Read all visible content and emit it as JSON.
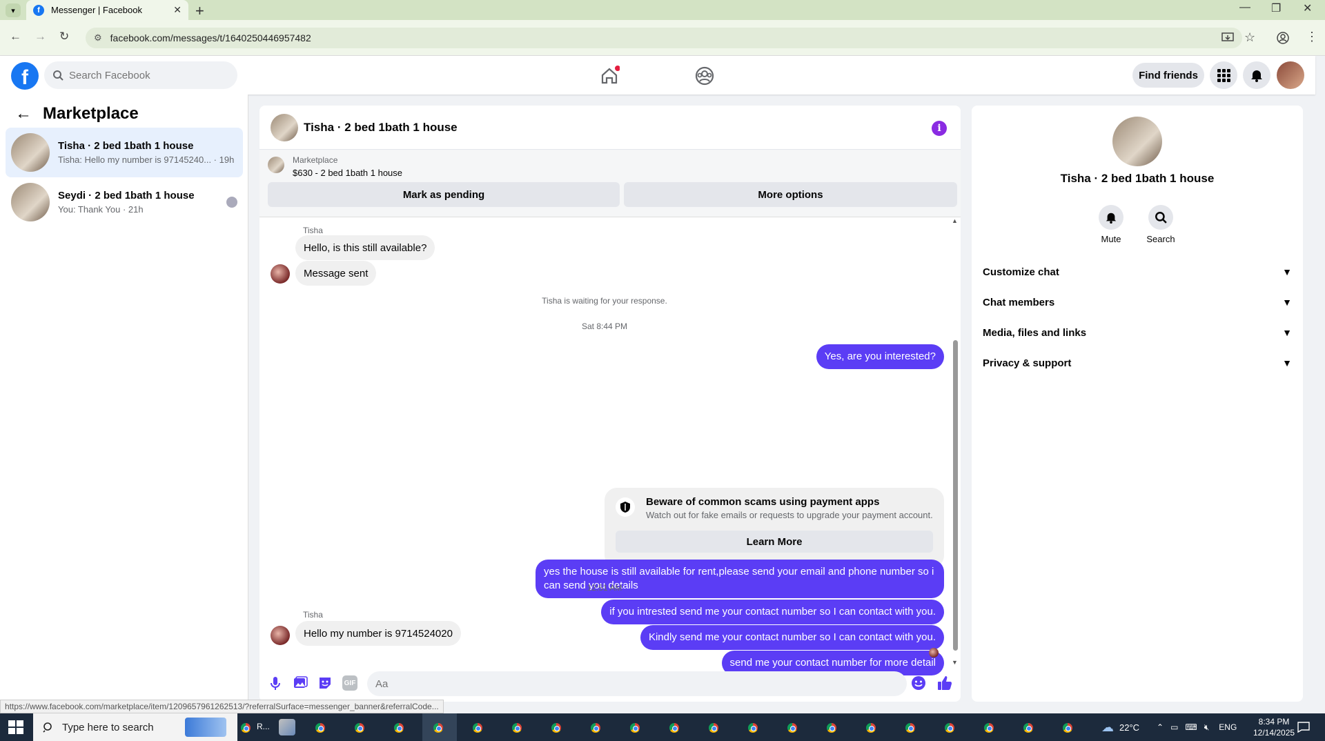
{
  "browser": {
    "tab_title": "Messenger | Facebook",
    "tab_close": "✕",
    "new_tab": "+",
    "url": "facebook.com/messages/t/1640250446957482",
    "status_url": "https://www.facebook.com/marketplace/item/1209657961262513/?referralSurface=messenger_banner&referralCode..."
  },
  "fb": {
    "search_placeholder": "Search Facebook",
    "find_friends": "Find friends",
    "logo_letter": "f"
  },
  "left": {
    "title": "Marketplace",
    "conversations": [
      {
        "name": "Tisha · 2 bed 1bath 1 house",
        "preview": "Tisha: Hello my number is 97145240... · 19h"
      },
      {
        "name": "Seydi · 2 bed 1bath 1 house",
        "preview": "You: Thank You · 21h"
      }
    ]
  },
  "chat": {
    "title": "Tisha · 2 bed 1bath 1 house",
    "banner_label": "Marketplace",
    "banner_price": "$630 - 2 bed 1bath 1 house",
    "mark_pending": "Mark as pending",
    "more_options": "More options",
    "sender1": "Tisha",
    "in1": "Hello, is this still available?",
    "in2": "Message sent",
    "waiting": "Tisha is waiting for your response.",
    "time1": "Sat 8:44 PM",
    "out1": "Yes, are you interested?",
    "scam_title": "Beware of common scams using payment apps",
    "scam_sub": "Watch out for fake emails or requests to upgrade your payment account.",
    "learn_more": "Learn More",
    "out2": "yes the house is still available for rent,please send your email and phone number so i can send you details",
    "out3": "if you intrested send me your contact number so I can contact with you.",
    "out4": "Kindly send me your contact number so I can contact with you.",
    "out5": "send me your contact number for more detail",
    "time2": "12:51 AM",
    "sender2": "Tisha",
    "in3": "Hello my number is 9714524020",
    "composer_placeholder": "Aa"
  },
  "right": {
    "name": "Tisha · 2 bed 1bath 1 house",
    "mute": "Mute",
    "search": "Search",
    "rows": [
      "Customize chat",
      "Chat members",
      "Media, files and links",
      "Privacy & support"
    ]
  },
  "taskbar": {
    "search_placeholder": "Type here to search",
    "app_label": "R...",
    "temp": "22°C",
    "lang": "ENG",
    "time": "8:34 PM",
    "date": "12/14/2025"
  },
  "colors": {
    "fb_blue": "#1877f2",
    "outgoing": "#5b3df5",
    "info": "#8a2be2"
  }
}
